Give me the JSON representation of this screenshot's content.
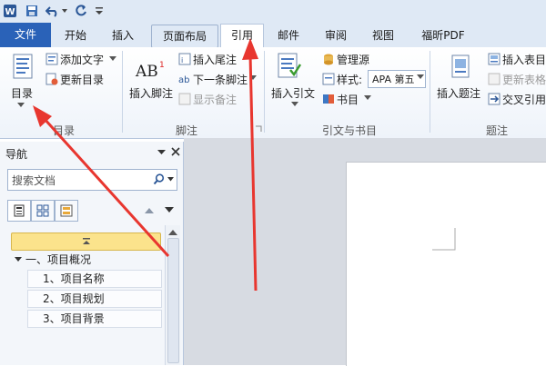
{
  "qat": {
    "app_icon": "word-icon",
    "save_icon": "save-icon",
    "undo_icon": "undo-icon",
    "redo_icon": "redo-icon",
    "customize_icon": "chevron-down-icon"
  },
  "tabs": [
    {
      "label": "文件"
    },
    {
      "label": "开始"
    },
    {
      "label": "插入"
    },
    {
      "label": "页面布局"
    },
    {
      "label": "引用"
    },
    {
      "label": "邮件"
    },
    {
      "label": "审阅"
    },
    {
      "label": "视图"
    },
    {
      "label": "福昕PDF"
    }
  ],
  "ribbon": {
    "toc": {
      "button": "目录",
      "add_text": "添加文字",
      "update": "更新目录",
      "group_label": "目录"
    },
    "footnote": {
      "insert": "插入脚注",
      "insert_endnote": "插入尾注",
      "next": "下一条脚注",
      "show_notes": "显示备注",
      "group_label": "脚注"
    },
    "citation": {
      "insert": "插入引文",
      "manage": "管理源",
      "style_label": "样式:",
      "style_value": "APA 第五",
      "bib": "书目",
      "group_label": "引文与书目"
    },
    "caption": {
      "insert": "插入题注",
      "insert_table": "插入表目",
      "update_table": "更新表格",
      "cross_ref": "交叉引用",
      "group_label": "题注"
    }
  },
  "nav": {
    "title": "导航",
    "search_placeholder": "搜索文档",
    "tree": [
      {
        "label": "一、项目概况",
        "level": 1
      },
      {
        "label": "1、项目名称",
        "level": 2
      },
      {
        "label": "2、项目规划",
        "level": 2
      },
      {
        "label": "3、项目背景",
        "level": 2
      }
    ]
  },
  "colors": {
    "file_tab": "#2a62b8",
    "ribbon_bg": "#eef3fa",
    "highlight": "#fbe38c",
    "arrow": "#e8362f"
  }
}
